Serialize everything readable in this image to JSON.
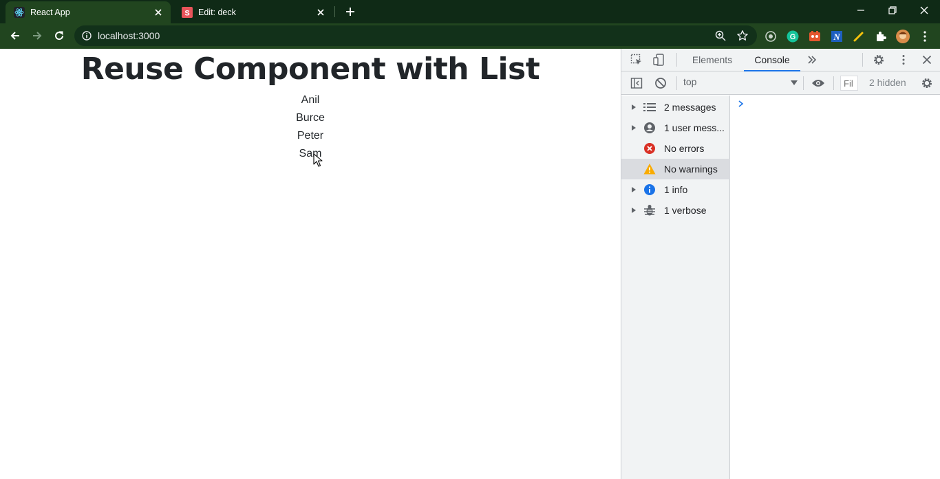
{
  "browser": {
    "tabs": [
      {
        "title": "React App",
        "active": true,
        "favicon": "react-logo-icon"
      },
      {
        "title": "Edit: deck",
        "active": false,
        "favicon": "s-logo-icon"
      }
    ],
    "url": "localhost:3000"
  },
  "page": {
    "heading": "Reuse Component with List",
    "names": [
      "Anil",
      "Burce",
      "Peter",
      "Sam"
    ]
  },
  "devtools": {
    "tabs": [
      "Elements",
      "Console"
    ],
    "active_tab": "Console",
    "context": "top",
    "filter_placeholder": "Fil",
    "hidden": "2 hidden",
    "sidebar": [
      {
        "label": "2 messages",
        "icon": "list-icon",
        "expandable": true
      },
      {
        "label": "1 user mess...",
        "icon": "user-icon",
        "expandable": true
      },
      {
        "label": "No errors",
        "icon": "error-icon",
        "expandable": false
      },
      {
        "label": "No warnings",
        "icon": "warning-icon",
        "expandable": false,
        "selected": true
      },
      {
        "label": "1 info",
        "icon": "info-icon",
        "expandable": true
      },
      {
        "label": "1 verbose",
        "icon": "bug-icon",
        "expandable": true
      }
    ]
  },
  "colors": {
    "chrome_frame": "#0f2a16",
    "chrome_toolbar": "#21451f",
    "devtools_accent": "#1a73e8",
    "error": "#d93025",
    "warning": "#f9ab00",
    "info": "#1a73e8"
  }
}
